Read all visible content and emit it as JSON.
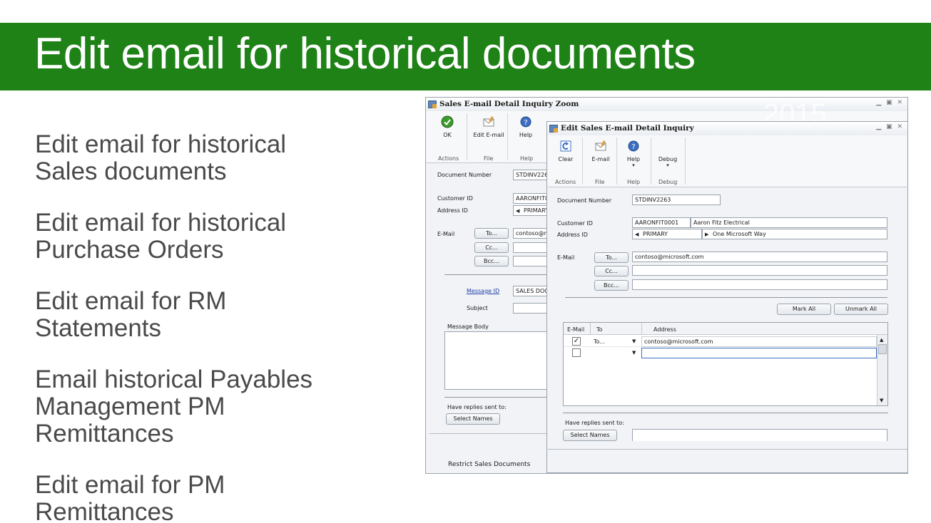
{
  "slide": {
    "title": "Edit email for historical documents",
    "bullets": [
      "Edit email for historical Sales documents",
      "Edit email for historical Purchase Orders",
      "Edit email for RM Statements",
      "Email historical Payables Management PM Remittances",
      "Edit email for PM Remittances"
    ]
  },
  "back_window": {
    "title": "Sales E-mail Detail Inquiry Zoom",
    "ribbon": {
      "buttons": [
        {
          "label": "OK",
          "icon": "checkmark-icon"
        },
        {
          "label": "Edit E-mail",
          "icon": "edit-email-icon"
        },
        {
          "label": "Help",
          "icon": "help-icon"
        }
      ],
      "groups": [
        "Actions",
        "File",
        "Help"
      ]
    },
    "document_number_label": "Document Number",
    "document_number": "STDINV2263",
    "customer_id_label": "Customer ID",
    "customer_id": "AARONFIT0001",
    "address_id_label": "Address ID",
    "address_id": "PRIMARY",
    "email_label": "E-Mail",
    "to_button": "To...",
    "cc_button": "Cc...",
    "bcc_button": "Bcc...",
    "to_value": "contoso@microsoft.com",
    "message_id_label": "Message ID",
    "message_id": "SALES DOC",
    "subject_label": "Subject",
    "message_body_label": "Message Body",
    "replies_label": "Have replies sent to:",
    "select_names": "Select Names",
    "restrict_label": "Restrict Sales Documents"
  },
  "front_window": {
    "title": "Edit Sales E-mail Detail Inquiry",
    "year_watermark": "2015",
    "ribbon": {
      "buttons": [
        {
          "label": "Clear",
          "icon": "clear-icon"
        },
        {
          "label": "E-mail",
          "icon": "email-icon"
        },
        {
          "label": "Help",
          "icon": "help-icon"
        },
        {
          "label": "Debug",
          "icon": "debug-icon"
        }
      ],
      "groups": [
        "Actions",
        "File",
        "Help",
        "Debug"
      ]
    },
    "document_number_label": "Document Number",
    "document_number": "STDINV2263",
    "customer_id_label": "Customer ID",
    "customer_id": "AARONFIT0001",
    "customer_name": "Aaron Fitz Electrical",
    "address_id_label": "Address ID",
    "address_id": "PRIMARY",
    "address_line": "One Microsoft Way",
    "email_label": "E-Mail",
    "to_button": "To...",
    "cc_button": "Cc...",
    "bcc_button": "Bcc...",
    "to_value": "contoso@microsoft.com",
    "mark_all": "Mark All",
    "unmark_all": "Unmark All",
    "grid": {
      "headers": [
        "E-Mail",
        "To",
        "Address"
      ],
      "rows": [
        {
          "checked": true,
          "to": "To...",
          "address": "contoso@microsoft.com"
        },
        {
          "checked": false,
          "to": "",
          "address": ""
        }
      ]
    },
    "replies_label": "Have replies sent to:",
    "select_names": "Select Names"
  }
}
